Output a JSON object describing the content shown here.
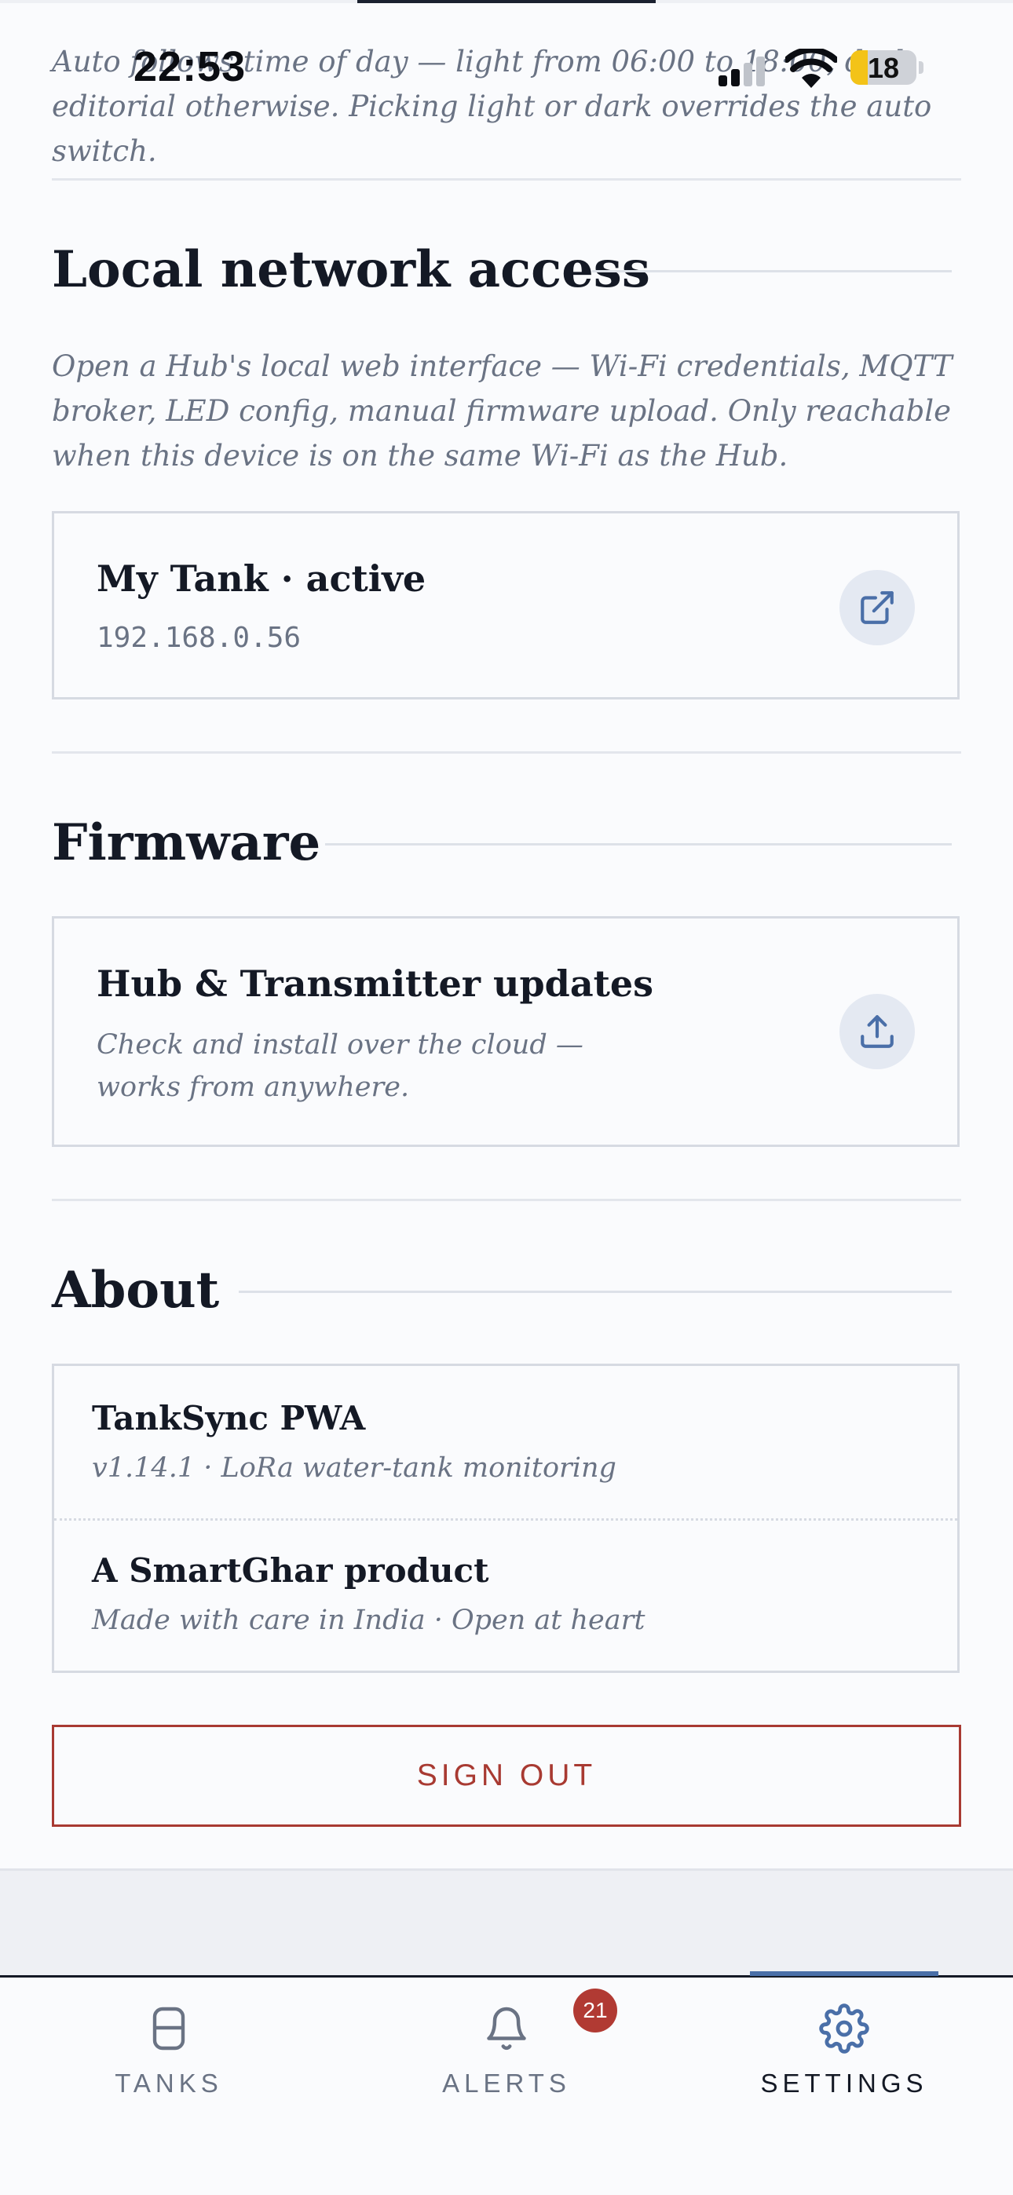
{
  "status_bar": {
    "time": "22:53",
    "battery_level": "18"
  },
  "appearance": {
    "description": "Auto follows time of day — light from 06:00 to 18:00, dark editorial otherwise. Picking light or dark overrides the auto switch."
  },
  "local_network": {
    "title": "Local network access",
    "description": "Open a Hub's local web interface — Wi-Fi credentials, MQTT broker, LED config, manual firmware upload. Only reachable when this device is on the same Wi-Fi as the Hub.",
    "device": {
      "name": "My Tank · active",
      "ip": "192.168.0.56",
      "action_icon": "external-link-icon"
    }
  },
  "firmware": {
    "title": "Firmware",
    "card": {
      "title": "Hub & Transmitter updates",
      "subtitle": "Check and install over the cloud — works from anywhere.",
      "action_icon": "upload-icon"
    }
  },
  "about": {
    "title": "About",
    "rows": [
      {
        "title": "TankSync PWA",
        "subtitle": "v1.14.1 · LoRa water-tank monitoring"
      },
      {
        "title": "A SmartGhar product",
        "subtitle": "Made with care in India · Open at heart"
      }
    ]
  },
  "sign_out_label": "SIGN OUT",
  "tabbar": {
    "tabs": [
      {
        "label": "TANKS",
        "icon": "tank-icon"
      },
      {
        "label": "ALERTS",
        "icon": "bell-icon",
        "badge": "21"
      },
      {
        "label": "SETTINGS",
        "icon": "gear-icon",
        "active": true
      }
    ]
  },
  "colors": {
    "accent": "#4a6fa8",
    "danger": "#a83a32",
    "badge": "#b13a33"
  }
}
